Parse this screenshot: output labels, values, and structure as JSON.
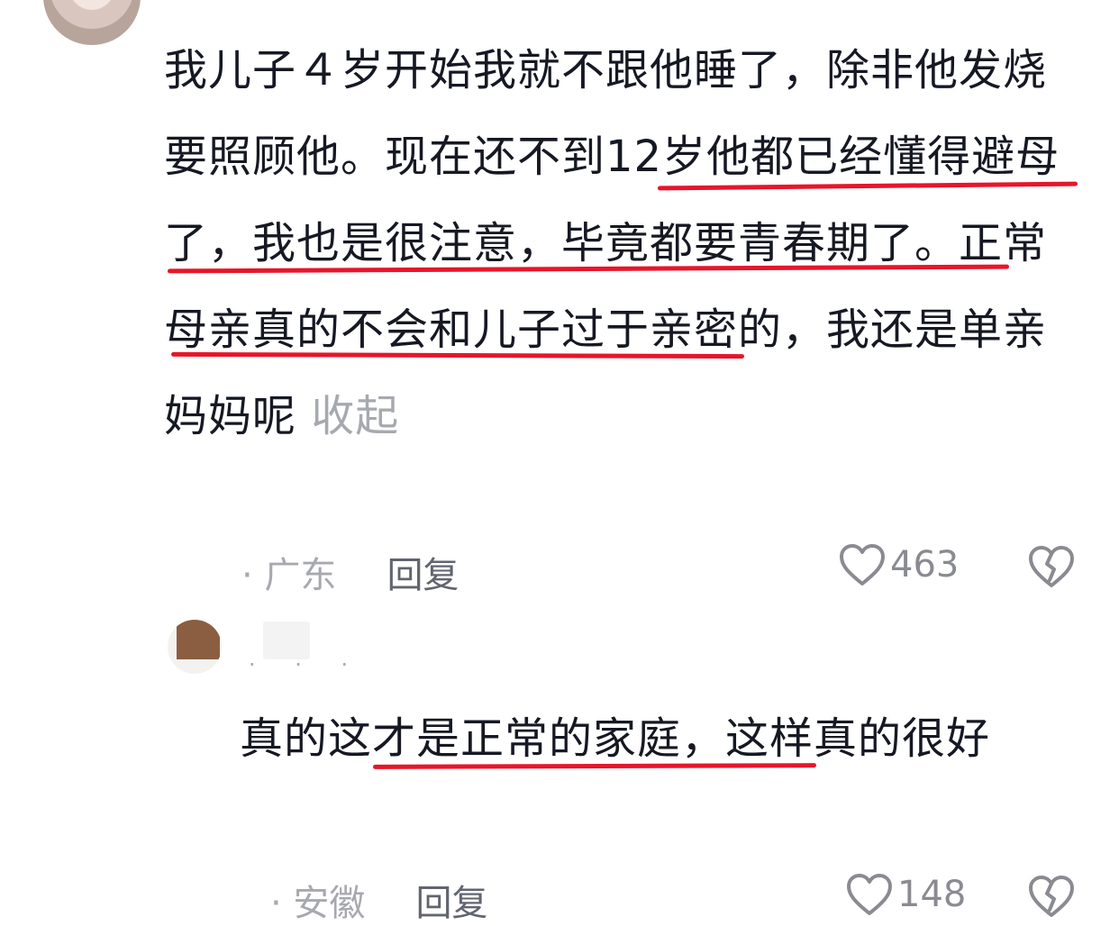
{
  "comment": {
    "text_before_hl": "我儿子４岁开始我就不跟他睡了，除非他发烧要照顾他。",
    "text_highlight": "现在还不到12岁他都已经懂得避母了，我也是很注意，毕竟都要青春期了。",
    "text_after_hl": "正常母亲真的不会和儿子过于亲密的，我还是单亲妈妈呢",
    "collapse_label": "收起",
    "location": "· 广东",
    "reply_label": "回复",
    "like_count": "463"
  },
  "reply": {
    "text_pre": "真的",
    "text_highlight": "这才是正常的家庭，",
    "text_post": "这样真的很好",
    "location": "· 安徽",
    "reply_label": "回复",
    "like_count": "148"
  },
  "colors": {
    "highlight_underline": "#e8152a",
    "meta_text": "#a8a9af"
  },
  "icons": [
    "heart-icon",
    "broken-heart-icon"
  ]
}
